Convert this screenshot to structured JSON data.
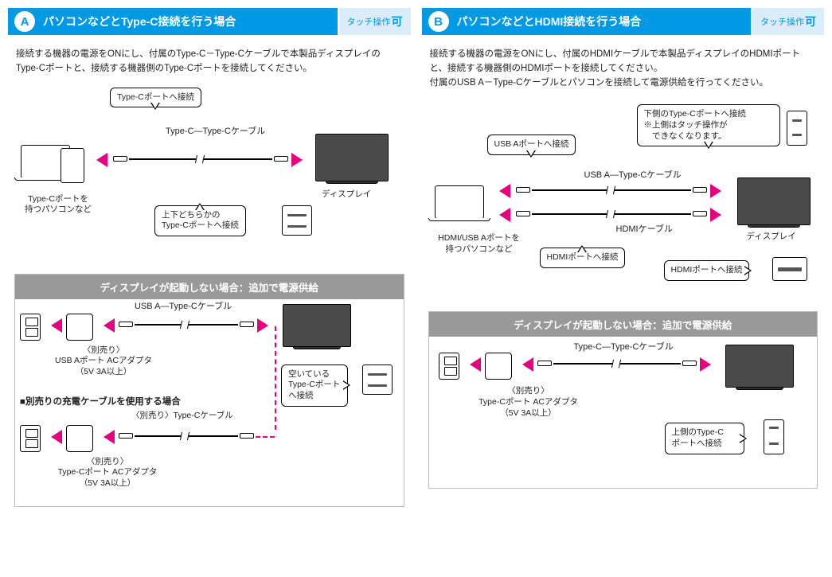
{
  "A": {
    "letter": "A",
    "title": "パソコンなどとType-C接続を行う場合",
    "tag_pre": "タッチ操作",
    "tag_big": "可",
    "desc": "接続する機器の電源をONにし、付属のType-C－Type-Cケーブルで本製品ディスプレイのType-Cポートと、接続する機器側のType-Cポートを接続してください。",
    "callout_port": "Type-Cポートへ接続",
    "cable_label": "Type-C—Type-Cケーブル",
    "device_label": "Type-Cポートを\n持つパソコンなど",
    "display_label": "ディスプレイ",
    "callout_either": "上下どちらかの\nType-Cポートへ接続",
    "ts_hdr": "ディスプレイが起動しない場合：追加で電源供給",
    "ts_cable1": "USB A—Type-Cケーブル",
    "ts_adapter1": "〈別売り〉\nUSB Aポート ACアダプタ\n（5V 3A以上）",
    "ts_callout_free": "空いている\nType-Cポート\nへ接続",
    "ts_sub": "■別売りの充電ケーブルを使用する場合",
    "ts_cable2": "〈別売り〉Type-Cケーブル",
    "ts_adapter2": "〈別売り〉\nType-Cポート ACアダプタ\n（5V 3A以上）"
  },
  "B": {
    "letter": "B",
    "title": "パソコンなどとHDMI接続を行う場合",
    "tag_pre": "タッチ操作",
    "tag_big": "可",
    "desc": "接続する機器の電源をONにし、付属のHDMIケーブルで本製品ディスプレイのHDMIポートと、接続する機器側のHDMIポートを接続してください。\n付属のUSB A－Type-Cケーブルとパソコンを接続して電源供給を行ってください。",
    "callout_usba": "USB Aポートへ接続",
    "callout_lower": "下側のType-Cポートへ接続\n※上側はタッチ操作が\n　できなくなります。",
    "cable_usb": "USB A—Type-Cケーブル",
    "cable_hdmi": "HDMIケーブル",
    "device_label": "HDMI/USB Aポートを\n持つパソコンなど",
    "display_label": "ディスプレイ",
    "callout_hdmi_pc": "HDMIポートへ接続",
    "callout_hdmi_disp": "HDMIポートへ接続",
    "ts_hdr": "ディスプレイが起動しない場合：追加で電源供給",
    "ts_cable": "Type-C—Type-Cケーブル",
    "ts_adapter": "〈別売り〉\nType-Cポート ACアダプタ\n（5V 3A以上）",
    "ts_callout_upper": "上側のType-C\nポートへ接続"
  }
}
